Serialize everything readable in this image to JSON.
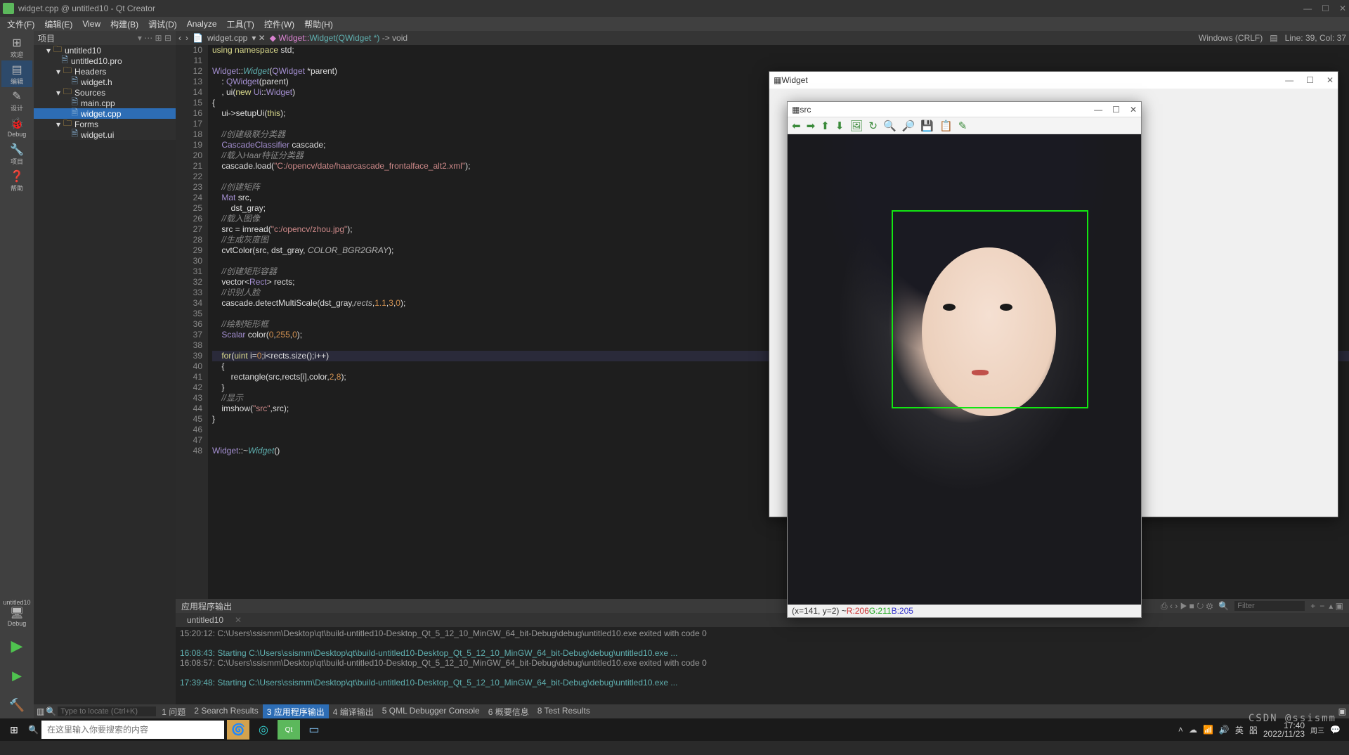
{
  "window": {
    "title": "widget.cpp @ untitled10 - Qt Creator",
    "controls": {
      "min": "—",
      "max": "☐",
      "close": "✕"
    }
  },
  "menu": [
    "文件(F)",
    "编辑(E)",
    "View",
    "构建(B)",
    "调试(D)",
    "Analyze",
    "工具(T)",
    "控件(W)",
    "帮助(H)"
  ],
  "leftrail": {
    "items": [
      {
        "icon": "⊞",
        "label": "欢迎"
      },
      {
        "icon": "▤",
        "label": "编辑"
      },
      {
        "icon": "✎",
        "label": "设计"
      },
      {
        "icon": "🐞",
        "label": "Debug"
      },
      {
        "icon": "🔧",
        "label": "项目"
      },
      {
        "icon": "❓",
        "label": "帮助"
      }
    ],
    "target": {
      "name": "untitled10",
      "config": "Debug",
      "icon": "🖥"
    }
  },
  "project_header": "项目",
  "tree": [
    {
      "level": 1,
      "type": "fold",
      "exp": "▾",
      "label": "untitled10"
    },
    {
      "level": 2,
      "type": "file",
      "exp": "",
      "label": "untitled10.pro"
    },
    {
      "level": 2,
      "type": "fold",
      "exp": "▾",
      "label": "Headers"
    },
    {
      "level": 3,
      "type": "file",
      "exp": "",
      "label": "widget.h"
    },
    {
      "level": 2,
      "type": "fold",
      "exp": "▾",
      "label": "Sources"
    },
    {
      "level": 3,
      "type": "file",
      "exp": "",
      "label": "main.cpp"
    },
    {
      "level": 3,
      "type": "file",
      "exp": "",
      "label": "widget.cpp",
      "sel": true
    },
    {
      "level": 2,
      "type": "fold",
      "exp": "▾",
      "label": "Forms"
    },
    {
      "level": 3,
      "type": "file",
      "exp": "",
      "label": "widget.ui"
    }
  ],
  "editor": {
    "tab_icon": "📄",
    "tab_file": "widget.cpp",
    "crumb_cls": "Widget::",
    "crumb_fn": "Widget(QWidget *)",
    "crumb_ret": " -> void",
    "encoding": "Windows (CRLF)",
    "position": "Line: 39, Col: 37",
    "lines": [
      {
        "n": 10,
        "html": "<span class='kw'>using</span> <span class='kw'>namespace</span> std;"
      },
      {
        "n": 11,
        "html": ""
      },
      {
        "n": 12,
        "html": "<span class='cls'>Widget</span>::<span class='fn'>Widget</span>(<span class='cls'>QWidget</span> *parent)"
      },
      {
        "n": 13,
        "html": "    : <span class='cls'>QWidget</span>(parent)"
      },
      {
        "n": 14,
        "html": "    , ui(<span class='kw'>new</span> <span class='cls'>Ui</span>::<span class='cls'>Widget</span>)"
      },
      {
        "n": 15,
        "html": "{"
      },
      {
        "n": 16,
        "html": "    ui-&gt;setupUi(<span class='kw'>this</span>);"
      },
      {
        "n": 17,
        "html": ""
      },
      {
        "n": 18,
        "html": "    <span class='cmt'>//创建级联分类器</span>"
      },
      {
        "n": 19,
        "html": "    <span class='cls'>CascadeClassifier</span> cascade;"
      },
      {
        "n": 20,
        "html": "    <span class='cmt'>//载入Haar特征分类器</span>"
      },
      {
        "n": 21,
        "html": "    cascade.load(<span class='str'>\"C:/opencv/date/haarcascade_frontalface_alt2.xml\"</span>);"
      },
      {
        "n": 22,
        "html": ""
      },
      {
        "n": 23,
        "html": "    <span class='cmt'>//创建矩阵</span>"
      },
      {
        "n": 24,
        "html": "    <span class='cls'>Mat</span> src,"
      },
      {
        "n": 25,
        "html": "        dst_gray;"
      },
      {
        "n": 26,
        "html": "    <span class='cmt'>//载入图像</span>"
      },
      {
        "n": 27,
        "html": "    src = imread(<span class='str'>\"c:/opencv/zhou.jpg\"</span>);"
      },
      {
        "n": 28,
        "html": "    <span class='cmt'>//生成灰度图</span>"
      },
      {
        "n": 29,
        "html": "    cvtColor(src, dst_gray, <span class='ital'>COLOR_BGR2GRAY</span>);"
      },
      {
        "n": 30,
        "html": ""
      },
      {
        "n": 31,
        "html": "    <span class='cmt'>//创建矩形容器</span>"
      },
      {
        "n": 32,
        "html": "    vector&lt;<span class='cls'>Rect</span>&gt; rects;"
      },
      {
        "n": 33,
        "html": "    <span class='cmt'>//识别人脸</span>"
      },
      {
        "n": 34,
        "html": "    cascade.detectMultiScale(dst_gray,<span class='ital'>rects</span>,<span class='num'>1.1</span>,<span class='num'>3</span>,<span class='num'>0</span>);"
      },
      {
        "n": 35,
        "html": ""
      },
      {
        "n": 36,
        "html": "    <span class='cmt'>//绘制矩形框</span>"
      },
      {
        "n": 37,
        "html": "    <span class='cls'>Scalar</span> color(<span class='num'>0</span>,<span class='num'>255</span>,<span class='num'>0</span>);"
      },
      {
        "n": 38,
        "html": ""
      },
      {
        "n": 39,
        "html": "    <span class='kw'>for</span><span class='curline'>(<span class='kw'>uint</span> i=<span class='num'>0</span>;i&lt;rects.size();i++)</span>",
        "cur": true
      },
      {
        "n": 40,
        "html": "    {"
      },
      {
        "n": 41,
        "html": "        rectangle(src,rects[i],color,<span class='num'>2</span>,<span class='num'>8</span>);"
      },
      {
        "n": 42,
        "html": "    }"
      },
      {
        "n": 43,
        "html": "    <span class='cmt'>//显示</span>"
      },
      {
        "n": 44,
        "html": "    imshow(<span class='str'>\"src\"</span>,src);"
      },
      {
        "n": 45,
        "html": "}"
      },
      {
        "n": 46,
        "html": ""
      },
      {
        "n": 47,
        "html": ""
      },
      {
        "n": 48,
        "html": "<span class='cls'>Widget</span>::~<span class='fn'>Widget</span>()"
      }
    ]
  },
  "output": {
    "title": "应用程序输出",
    "filter_ph": "Filter",
    "tab_label": "untitled10",
    "lines": [
      {
        "cls": "",
        "text": "15:20:12: C:\\Users\\ssismm\\Desktop\\qt\\build-untitled10-Desktop_Qt_5_12_10_MinGW_64_bit-Debug\\debug\\untitled10.exe exited with code 0"
      },
      {
        "cls": "",
        "text": ""
      },
      {
        "cls": "starting",
        "text": "16:08:43: Starting C:\\Users\\ssismm\\Desktop\\qt\\build-untitled10-Desktop_Qt_5_12_10_MinGW_64_bit-Debug\\debug\\untitled10.exe ..."
      },
      {
        "cls": "",
        "text": "16:08:57: C:\\Users\\ssismm\\Desktop\\qt\\build-untitled10-Desktop_Qt_5_12_10_MinGW_64_bit-Debug\\debug\\untitled10.exe exited with code 0"
      },
      {
        "cls": "",
        "text": ""
      },
      {
        "cls": "starting",
        "text": "17:39:48: Starting C:\\Users\\ssismm\\Desktop\\qt\\build-untitled10-Desktop_Qt_5_12_10_MinGW_64_bit-Debug\\debug\\untitled10.exe ..."
      }
    ]
  },
  "bottom": {
    "search_ph": "Type to locate (Ctrl+K)",
    "tabs": [
      "1 问题",
      "2 Search Results",
      "3 应用程序输出",
      "4 编译输出",
      "5 QML Debugger Console",
      "6 概要信息",
      "8 Test Results"
    ],
    "sel": 2
  },
  "taskbar": {
    "search_ph": "在这里输入你要搜索的内容",
    "tray": {
      "ime": "英",
      "vol": "🔊",
      "net": "📶",
      "time": "17:40",
      "date": "2022/11/23",
      "day": "周三"
    }
  },
  "widgetwin": {
    "title": "Widget"
  },
  "srcwin": {
    "title": "src",
    "toolbar": [
      "⬅",
      "➡",
      "⬆",
      "⬇",
      "🖼",
      "↻",
      "🔍",
      "🔎",
      "💾",
      "📋",
      "✎"
    ],
    "status_xy": "(x=141, y=2) ~ ",
    "status_r": "R:206 ",
    "status_g": "G:211 ",
    "status_b": "B:205"
  },
  "watermark": "CSDN @ssismm"
}
